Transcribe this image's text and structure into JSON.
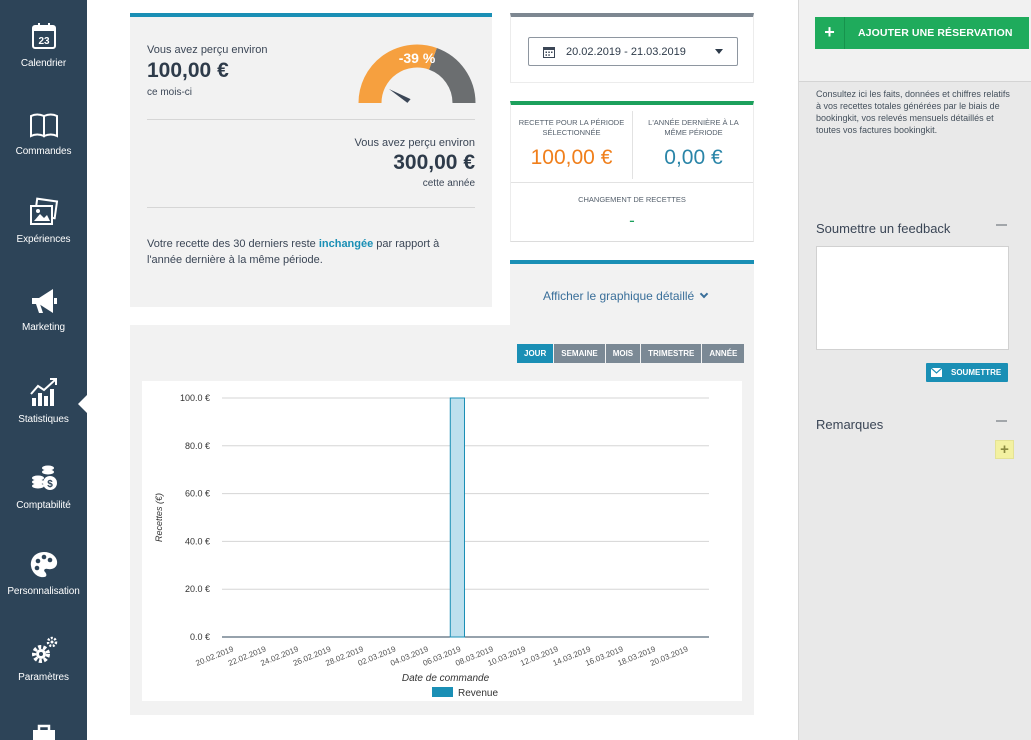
{
  "sidebar": {
    "items": [
      {
        "label": "Calendrier",
        "icon": "calendar-icon",
        "badge": "23"
      },
      {
        "label": "Commandes",
        "icon": "book-icon"
      },
      {
        "label": "Expériences",
        "icon": "photos-icon"
      },
      {
        "label": "Marketing",
        "icon": "megaphone-icon"
      },
      {
        "label": "Statistiques",
        "icon": "chart-growth-icon",
        "active": true
      },
      {
        "label": "Comptabilité",
        "icon": "coins-icon"
      },
      {
        "label": "Personnalisation",
        "icon": "palette-icon"
      },
      {
        "label": "Paramètres",
        "icon": "gears-icon"
      }
    ]
  },
  "summary": {
    "month_intro": "Vous avez perçu environ",
    "month_amount": "100,00 €",
    "month_caption": "ce mois-ci",
    "gauge_label": "-39 %",
    "gauge_fraction": 0.61,
    "year_intro": "Vous avez perçu environ",
    "year_amount": "300,00 €",
    "year_caption": "cette année",
    "sentence_before": "Votre recette des 30 derniers reste ",
    "sentence_highlight": "inchangée",
    "sentence_after": " par rapport à l'année dernière à la même période."
  },
  "date_range": {
    "value": "20.02.2019 - 21.03.2019"
  },
  "stats": {
    "selected_label": "Recette pour la période sélectionnée",
    "selected_value": "100,00 €",
    "last_year_label": "L'année dernière à la même période",
    "last_year_value": "0,00 €",
    "change_label": "Changement de recettes",
    "change_value": "-"
  },
  "toggle": {
    "label": "Afficher le graphique détaillé"
  },
  "period_tabs": [
    {
      "label": "Jour",
      "active": true
    },
    {
      "label": "Semaine"
    },
    {
      "label": "Mois"
    },
    {
      "label": "Trimestre"
    },
    {
      "label": "Année"
    }
  ],
  "chart_data": {
    "type": "bar",
    "xlabel": "Date de commande",
    "ylabel": "Recettes (€)",
    "ylim": [
      0,
      100
    ],
    "yticks": [
      "0.0 €",
      "20.0 €",
      "40.0 €",
      "60.0 €",
      "80.0 €",
      "100.0 €"
    ],
    "ytick_values": [
      0,
      20,
      40,
      60,
      80,
      100
    ],
    "xtick_labels": [
      "20.02.2019",
      "22.02.2019",
      "24.02.2019",
      "26.02.2019",
      "28.02.2019",
      "02.03.2019",
      "04.03.2019",
      "06.03.2019",
      "08.03.2019",
      "10.03.2019",
      "12.03.2019",
      "14.03.2019",
      "16.03.2019",
      "18.03.2019",
      "20.03.2019"
    ],
    "categories": [
      "20.02.2019",
      "21.02.2019",
      "22.02.2019",
      "23.02.2019",
      "24.02.2019",
      "25.02.2019",
      "26.02.2019",
      "27.02.2019",
      "28.02.2019",
      "01.03.2019",
      "02.03.2019",
      "03.03.2019",
      "04.03.2019",
      "05.03.2019",
      "06.03.2019",
      "07.03.2019",
      "08.03.2019",
      "09.03.2019",
      "10.03.2019",
      "11.03.2019",
      "12.03.2019",
      "13.03.2019",
      "14.03.2019",
      "15.03.2019",
      "16.03.2019",
      "17.03.2019",
      "18.03.2019",
      "19.03.2019",
      "20.03.2019",
      "21.03.2019"
    ],
    "series": [
      {
        "name": "Revenue",
        "values": [
          0,
          0,
          0,
          0,
          0,
          0,
          0,
          0,
          0,
          0,
          0,
          0,
          0,
          0,
          100,
          0,
          0,
          0,
          0,
          0,
          0,
          0,
          0,
          0,
          0,
          0,
          0,
          0,
          0,
          0
        ]
      }
    ],
    "legend_position": "bottom",
    "grid": true,
    "colors": {
      "bar_fill": "#bde0ee",
      "bar_stroke": "#1a8fb5",
      "legend": "#1a8fb5"
    }
  },
  "right": {
    "add_reservation_label": "Ajouter une réservation",
    "info_text": "Consultez ici les faits, données et chiffres relatifs à vos recettes totales générées par le biais de bookingkit, vos relevés mensuels détaillés et toutes vos factures bookingkit.",
    "feedback_heading": "Soumettre un feedback",
    "feedback_value": "",
    "submit_label": "Soumettre",
    "remarks_heading": "Remarques"
  },
  "colors": {
    "sidebar": "#2d4458",
    "accent_blue": "#1a8fb5",
    "accent_green": "#1fab5c",
    "gauge_orange": "#f6a03f",
    "gauge_gray": "#6b6e70",
    "selected_value_orange": "#f07f1b",
    "last_year_value_blue": "#2a85a8"
  }
}
